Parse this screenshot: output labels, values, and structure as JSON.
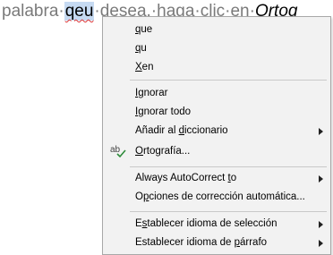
{
  "document": {
    "before": "palabra·",
    "selected_word": "qeu",
    "after_1": "·desea,·haga·clic·en·",
    "after_italic": "Ortog"
  },
  "context_menu": {
    "suggestions": [
      {
        "accel": "q",
        "rest": "ue"
      },
      {
        "accel": "q",
        "rest": "u"
      },
      {
        "accel": "X",
        "rest": "en"
      }
    ],
    "ignore": {
      "accel": "I",
      "rest": "gnorar"
    },
    "ignore_all": {
      "accel": "I",
      "rest": "gnorar todo"
    },
    "add_to_dictionary": {
      "pre": "Añadir al ",
      "accel": "d",
      "rest": "iccionario"
    },
    "spelling": {
      "accel": "O",
      "rest": "rtografía..."
    },
    "spelling_icon": "spellcheck-icon",
    "autocorrect": {
      "pre": "Always AutoCorrect ",
      "accel": "t",
      "rest": "o"
    },
    "autocorrect_options": {
      "pre": "O",
      "accel": "p",
      "rest": "ciones de corrección automática..."
    },
    "set_selection_language": {
      "pre": "E",
      "accel": "s",
      "rest": "tablecer idioma de selección"
    },
    "set_paragraph_language": {
      "pre": "Establecer idioma de ",
      "accel": "p",
      "rest": "árrafo"
    }
  }
}
